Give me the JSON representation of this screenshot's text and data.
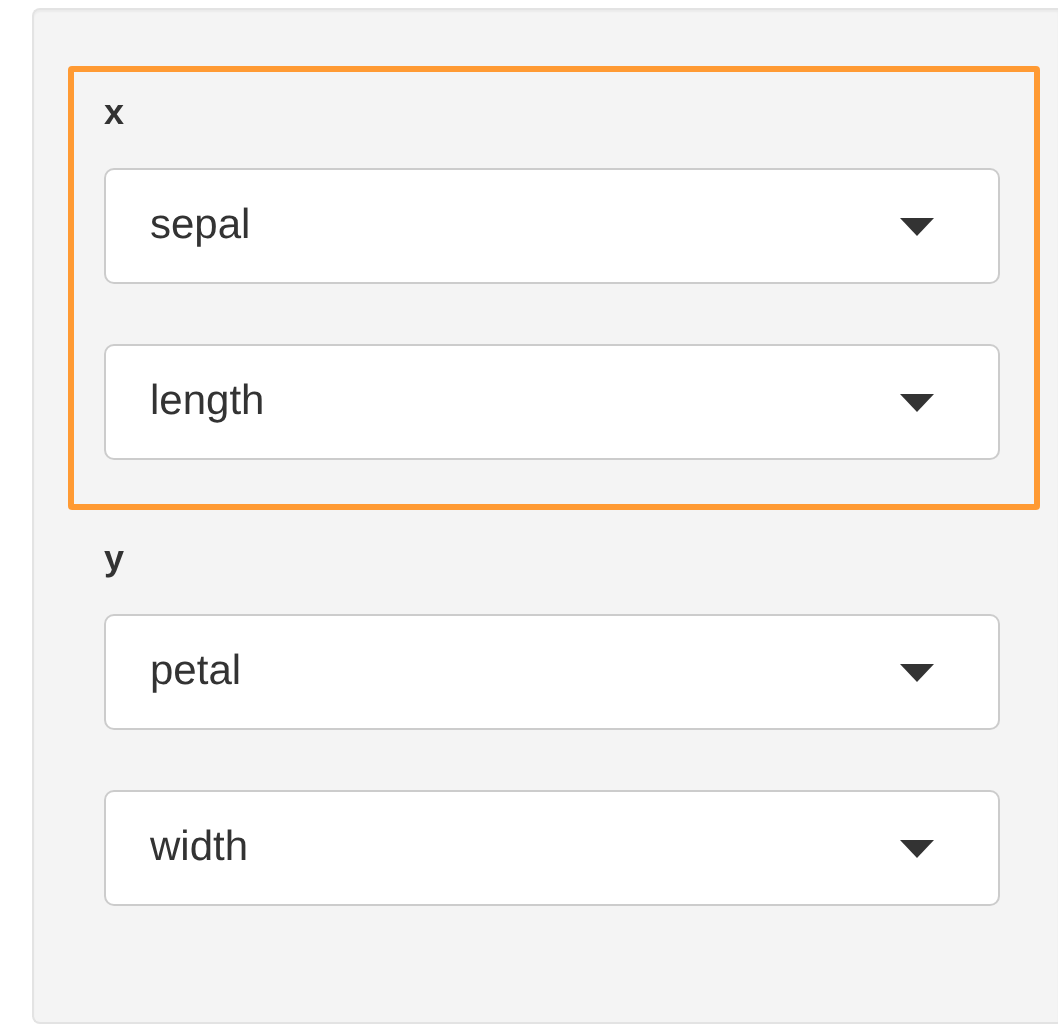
{
  "groups": [
    {
      "label": "x",
      "highlighted": true,
      "selects": [
        {
          "value": "sepal"
        },
        {
          "value": "length"
        }
      ]
    },
    {
      "label": "y",
      "highlighted": false,
      "selects": [
        {
          "value": "petal"
        },
        {
          "value": "width"
        }
      ]
    }
  ]
}
